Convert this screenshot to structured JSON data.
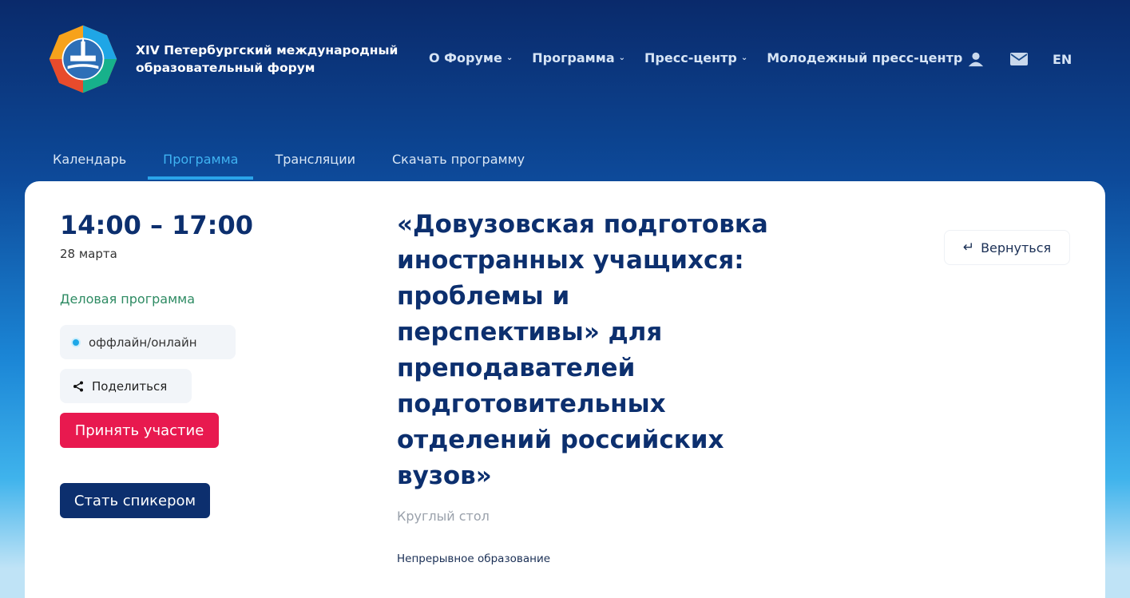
{
  "header": {
    "brand_title": "XIV Петербургский международный образовательный форум",
    "nav": [
      {
        "label": "О Форуме",
        "has_dropdown": true
      },
      {
        "label": "Программа",
        "has_dropdown": true
      },
      {
        "label": "Пресс-центр",
        "has_dropdown": true
      },
      {
        "label": "Молодежный пресс-центр",
        "has_dropdown": false
      }
    ],
    "icons": [
      "user-icon",
      "mail-icon"
    ],
    "lang": "EN"
  },
  "subnav": {
    "tabs": [
      {
        "label": "Календарь",
        "active": false
      },
      {
        "label": "Программа",
        "active": true
      },
      {
        "label": "Трансляции",
        "active": false
      },
      {
        "label": "Скачать программу",
        "active": false
      }
    ]
  },
  "event": {
    "time": "14:00 – 17:00",
    "date": "28 марта",
    "program_type": "Деловая программа",
    "format": "оффлайн/онлайн",
    "share_label": "Поделиться",
    "join_label": "Принять участие",
    "speaker_label": "Стать спикером",
    "title": "«Довузовская подготовка иностранных учащихся: проблемы и перспективы» для преподавателей подготовительных отделений российских вузов»",
    "event_format": "Круглый стол",
    "track": "Непрерывное образование",
    "back_label": "Вернуться"
  },
  "colors": {
    "brand_dark": "#0c2f6e",
    "accent_red": "#e8194f",
    "accent_green": "#2e8b63",
    "active_tab": "#3fb3f2"
  }
}
